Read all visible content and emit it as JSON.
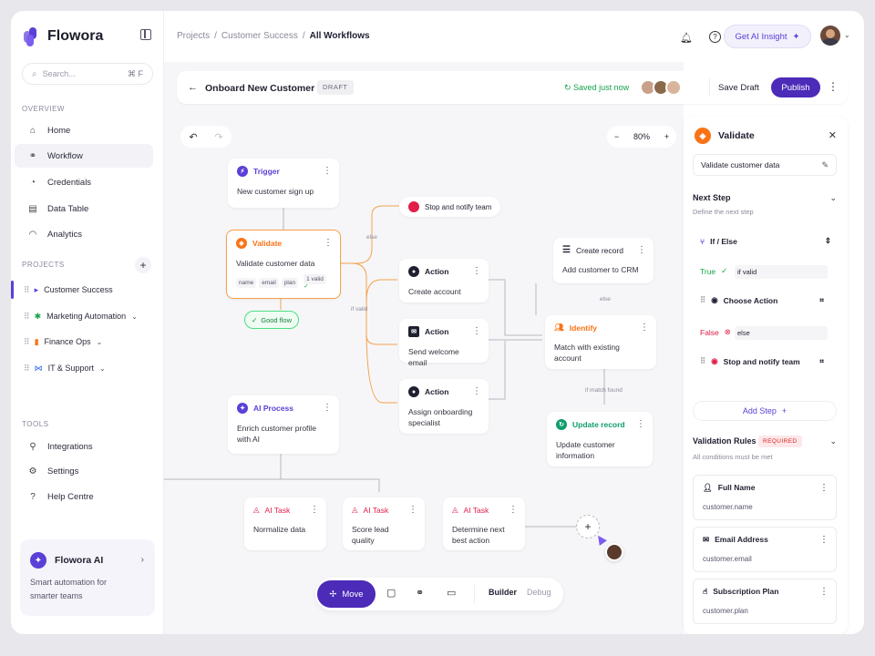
{
  "app": {
    "name": "Flowora"
  },
  "sidebar": {
    "search_placeholder": "Search...",
    "search_kbd": "⌘ F",
    "overview_label": "OVERVIEW",
    "nav": [
      {
        "label": "Home"
      },
      {
        "label": "Workflow"
      },
      {
        "label": "Credentials"
      },
      {
        "label": "Data Table"
      },
      {
        "label": "Analytics"
      }
    ],
    "projects_label": "PROJECTS",
    "projects": [
      {
        "label": "Customer Success"
      },
      {
        "label": "Marketing Automation"
      },
      {
        "label": "Finance Ops"
      },
      {
        "label": "IT & Support"
      }
    ],
    "tools_label": "TOOLS",
    "tools": [
      {
        "label": "Integrations"
      },
      {
        "label": "Settings"
      },
      {
        "label": "Help Centre"
      }
    ],
    "ai_card": {
      "title": "Flowora AI",
      "desc": "Smart automation for smarter teams"
    }
  },
  "topbar": {
    "crumbs": [
      "Projects",
      "Customer Success",
      "All Workflows"
    ],
    "ai_insight": "Get AI Insight"
  },
  "workflow": {
    "name": "Onboard New Customer",
    "status": "DRAFT",
    "saved": "Saved just now",
    "save_draft": "Save Draft",
    "publish": "Publish",
    "zoom": "80%"
  },
  "nodes": {
    "trigger": {
      "type": "Trigger",
      "body": "New customer sign up"
    },
    "validate": {
      "type": "Validate",
      "body": "Validate customer data",
      "tags": [
        "name",
        "email",
        "plan"
      ],
      "valid": "1 valid"
    },
    "good_flow": "Good flow",
    "stop": {
      "label": "Stop and notify team"
    },
    "action1": {
      "type": "Action",
      "body": "Create account"
    },
    "action2": {
      "type": "Action",
      "body": "Send welcome email"
    },
    "action3": {
      "type": "Action",
      "body": "Assign onboarding specialist"
    },
    "create_record": {
      "type": "Create record",
      "body": "Add customer to CRM"
    },
    "identify": {
      "type": "Identify",
      "body": "Match with existing account"
    },
    "update_record": {
      "type": "Update record",
      "body": "Update customer information"
    },
    "ai_process": {
      "type": "AI Process",
      "body": "Enrich customer profile with AI"
    },
    "ai_task1": {
      "type": "AI Task",
      "body": "Normalize data"
    },
    "ai_task2": {
      "type": "AI Task",
      "body": "Score lead quality"
    },
    "ai_task3": {
      "type": "AI Task",
      "body": "Determine next best action"
    },
    "edge_labels": {
      "else": "else",
      "if_valid": "if valid",
      "else2": "else",
      "if_match": "if match found"
    }
  },
  "toolbar": {
    "move": "Move",
    "builder": "Builder",
    "debug": "Debug"
  },
  "panel": {
    "title": "Validate",
    "name_value": "Validate customer data",
    "next_step": "Next Step",
    "next_step_sub": "Define the next step",
    "if_else": "If / Else",
    "true_label": "True",
    "true_cond": "if valid",
    "choose_action": "Choose Action",
    "false_label": "False",
    "false_cond": "else",
    "stop_notify": "Stop and notify team",
    "add_step": "Add Step",
    "rules_title": "Validation Rules",
    "rules_badge": "REQUIRED",
    "rules_sub": "All conditions must be met",
    "rules": [
      {
        "name": "Full Name",
        "value": "customer.name"
      },
      {
        "name": "Email Address",
        "value": "customer.email"
      },
      {
        "name": "Subscription Plan",
        "value": "customer.plan"
      }
    ]
  },
  "colors": {
    "brand": "#5b3fd6",
    "accent_orange": "#f97316",
    "success": "#16a34a",
    "danger": "#e11d48"
  }
}
